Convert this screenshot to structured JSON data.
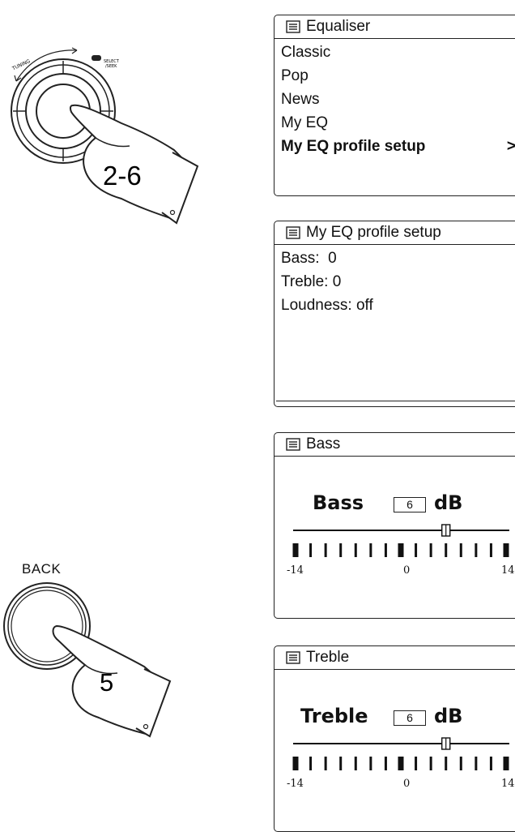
{
  "knob_top": {
    "tuning_label": "TUNING",
    "select_label_line1": "SELECT",
    "select_label_line2": "/SEEK",
    "step_label": "2-6"
  },
  "back_button": {
    "label": "BACK",
    "step_label": "5"
  },
  "screens": {
    "equaliser": {
      "title": "Equaliser",
      "items": [
        "Classic",
        "Pop",
        "News",
        "My EQ"
      ],
      "selected_item": "My EQ profile setup",
      "selected_arrow": ">"
    },
    "profile_setup": {
      "title": "My EQ profile setup",
      "lines": [
        "Bass:  0",
        "Treble: 0",
        "Loudness: off"
      ]
    },
    "bass": {
      "title": "Bass",
      "label": "Bass",
      "value": "6",
      "unit": "dB",
      "scale_min": "-14",
      "scale_mid": "0",
      "scale_max": "14",
      "level": 6,
      "range": [
        -14,
        14
      ]
    },
    "treble": {
      "title": "Treble",
      "label": "Treble",
      "value": "6",
      "unit": "dB",
      "scale_min": "-14",
      "scale_mid": "0",
      "scale_max": "14",
      "level": 6,
      "range": [
        -14,
        14
      ]
    }
  }
}
